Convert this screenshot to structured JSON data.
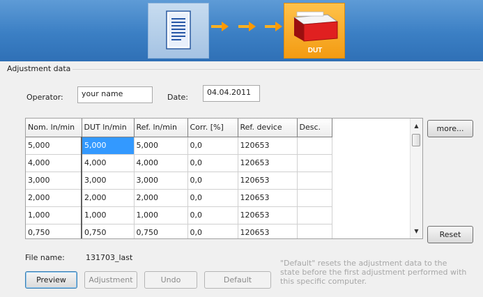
{
  "header": {
    "device_label": "DUT"
  },
  "icons": {
    "document": "document-icon",
    "arrow": "arrow-right-icon",
    "device": "dut-device-icon"
  },
  "colors": {
    "banner": "#3b7fc4",
    "arrow": "#ff9900",
    "dut_tile": "#f7a81e",
    "selection": "#3399ff"
  },
  "adjustment": {
    "section_title": "Adjustment data",
    "operator_label": "Operator:",
    "operator_value": "your name",
    "date_label": "Date:",
    "date_value": "04.04.2011"
  },
  "table": {
    "columns": [
      "Nom. ln/min",
      "DUT ln/min",
      "Ref. ln/min",
      "Corr. [%]",
      "Ref. device",
      "Desc."
    ],
    "rows": [
      [
        "5,000",
        "5,000",
        "5,000",
        "0,0",
        "120653",
        ""
      ],
      [
        "4,000",
        "4,000",
        "4,000",
        "0,0",
        "120653",
        ""
      ],
      [
        "3,000",
        "3,000",
        "3,000",
        "0,0",
        "120653",
        ""
      ],
      [
        "2,000",
        "2,000",
        "2,000",
        "0,0",
        "120653",
        ""
      ],
      [
        "1,000",
        "1,000",
        "1,000",
        "0,0",
        "120653",
        ""
      ],
      [
        "0,750",
        "0,750",
        "0,750",
        "0,0",
        "120653",
        ""
      ]
    ]
  },
  "buttons": {
    "more": "more...",
    "reset": "Reset",
    "preview": "Preview",
    "adjustment": "Adjustment",
    "undo": "Undo",
    "default": "Default"
  },
  "file": {
    "label": "File name:",
    "value": "131703_last"
  },
  "note": "\"Default\" resets the adjustment data to the state before the first adjustment performed with this specific computer."
}
